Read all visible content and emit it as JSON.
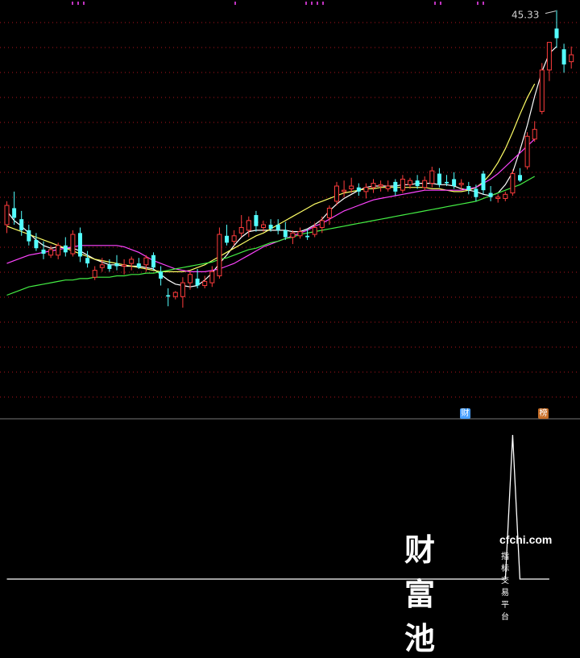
{
  "chart_data": [
    {
      "type": "candlestick",
      "max_label": "45.33",
      "ylim": [
        21,
        45.6
      ],
      "colors": {
        "up": "#ff3c3c",
        "down": "#54ffff",
        "background": "#000000",
        "grid": "#b4141e"
      },
      "candles": [
        {
          "o": 29.8,
          "h": 31.5,
          "l": 29.2,
          "c": 31.2
        },
        {
          "o": 31.0,
          "h": 32.2,
          "l": 29.8,
          "c": 30.3
        },
        {
          "o": 30.2,
          "h": 30.8,
          "l": 29.0,
          "c": 29.4
        },
        {
          "o": 29.4,
          "h": 29.8,
          "l": 28.3,
          "c": 28.6
        },
        {
          "o": 28.7,
          "h": 29.2,
          "l": 27.9,
          "c": 28.1
        },
        {
          "o": 28.0,
          "h": 28.6,
          "l": 27.3,
          "c": 27.7
        },
        {
          "o": 27.6,
          "h": 28.3,
          "l": 27.4,
          "c": 28.0
        },
        {
          "o": 27.6,
          "h": 28.5,
          "l": 27.3,
          "c": 28.3
        },
        {
          "o": 28.3,
          "h": 28.9,
          "l": 27.5,
          "c": 27.8
        },
        {
          "o": 27.7,
          "h": 29.4,
          "l": 27.5,
          "c": 29.1
        },
        {
          "o": 29.2,
          "h": 29.6,
          "l": 27.1,
          "c": 27.5
        },
        {
          "o": 27.4,
          "h": 27.9,
          "l": 26.7,
          "c": 27.0
        },
        {
          "o": 26.0,
          "h": 26.8,
          "l": 25.8,
          "c": 26.5
        },
        {
          "o": 26.7,
          "h": 27.4,
          "l": 26.4,
          "c": 26.9
        },
        {
          "o": 26.9,
          "h": 27.3,
          "l": 26.4,
          "c": 26.6
        },
        {
          "o": 27.0,
          "h": 27.6,
          "l": 26.5,
          "c": 26.8
        },
        {
          "o": 26.8,
          "h": 27.3,
          "l": 26.2,
          "c": 26.9
        },
        {
          "o": 27.0,
          "h": 27.5,
          "l": 26.5,
          "c": 27.3
        },
        {
          "o": 27.0,
          "h": 27.4,
          "l": 26.6,
          "c": 26.7
        },
        {
          "o": 26.9,
          "h": 27.6,
          "l": 26.4,
          "c": 27.4
        },
        {
          "o": 27.6,
          "h": 27.8,
          "l": 26.5,
          "c": 26.7
        },
        {
          "o": 26.4,
          "h": 26.8,
          "l": 25.4,
          "c": 25.9
        },
        {
          "o": 24.7,
          "h": 25.2,
          "l": 23.9,
          "c": 24.6
        },
        {
          "o": 24.6,
          "h": 25.0,
          "l": 24.4,
          "c": 24.9
        },
        {
          "o": 24.6,
          "h": 26.0,
          "l": 23.8,
          "c": 25.6
        },
        {
          "o": 25.6,
          "h": 26.4,
          "l": 25.1,
          "c": 26.2
        },
        {
          "o": 25.9,
          "h": 26.6,
          "l": 25.2,
          "c": 25.4
        },
        {
          "o": 25.4,
          "h": 26.1,
          "l": 25.2,
          "c": 25.7
        },
        {
          "o": 25.6,
          "h": 26.8,
          "l": 25.3,
          "c": 26.4
        },
        {
          "o": 26.1,
          "h": 29.6,
          "l": 25.9,
          "c": 29.1
        },
        {
          "o": 29.0,
          "h": 29.8,
          "l": 28.3,
          "c": 28.5
        },
        {
          "o": 28.6,
          "h": 29.4,
          "l": 28.3,
          "c": 29.0
        },
        {
          "o": 29.2,
          "h": 30.5,
          "l": 28.9,
          "c": 29.6
        },
        {
          "o": 29.4,
          "h": 30.4,
          "l": 28.9,
          "c": 30.1
        },
        {
          "o": 30.5,
          "h": 30.8,
          "l": 29.3,
          "c": 29.7
        },
        {
          "o": 29.6,
          "h": 30.1,
          "l": 29.3,
          "c": 29.8
        },
        {
          "o": 29.8,
          "h": 30.2,
          "l": 29.3,
          "c": 29.5
        },
        {
          "o": 29.8,
          "h": 30.2,
          "l": 29.1,
          "c": 29.4
        },
        {
          "o": 29.4,
          "h": 30.0,
          "l": 28.7,
          "c": 28.9
        },
        {
          "o": 28.9,
          "h": 29.4,
          "l": 28.4,
          "c": 29.2
        },
        {
          "o": 29.0,
          "h": 29.6,
          "l": 28.8,
          "c": 29.3
        },
        {
          "o": 29.0,
          "h": 29.5,
          "l": 28.7,
          "c": 28.9
        },
        {
          "o": 29.1,
          "h": 29.9,
          "l": 28.9,
          "c": 29.6
        },
        {
          "o": 29.6,
          "h": 30.4,
          "l": 29.2,
          "c": 30.1
        },
        {
          "o": 30.3,
          "h": 31.2,
          "l": 29.8,
          "c": 31.0
        },
        {
          "o": 31.5,
          "h": 32.9,
          "l": 31.2,
          "c": 32.6
        },
        {
          "o": 32.2,
          "h": 33.0,
          "l": 31.8,
          "c": 32.3
        },
        {
          "o": 32.4,
          "h": 33.2,
          "l": 32.1,
          "c": 32.6
        },
        {
          "o": 32.5,
          "h": 32.8,
          "l": 31.9,
          "c": 32.2
        },
        {
          "o": 32.2,
          "h": 32.8,
          "l": 31.7,
          "c": 32.5
        },
        {
          "o": 32.5,
          "h": 33.1,
          "l": 32.1,
          "c": 32.8
        },
        {
          "o": 32.6,
          "h": 33.0,
          "l": 32.2,
          "c": 32.7
        },
        {
          "o": 32.4,
          "h": 33.0,
          "l": 32.2,
          "c": 32.6
        },
        {
          "o": 32.9,
          "h": 33.1,
          "l": 31.9,
          "c": 32.2
        },
        {
          "o": 32.3,
          "h": 33.4,
          "l": 32.1,
          "c": 33.1
        },
        {
          "o": 32.7,
          "h": 33.2,
          "l": 32.4,
          "c": 33.0
        },
        {
          "o": 33.0,
          "h": 33.4,
          "l": 32.4,
          "c": 32.6
        },
        {
          "o": 32.5,
          "h": 33.3,
          "l": 32.3,
          "c": 33.0
        },
        {
          "o": 32.8,
          "h": 34.0,
          "l": 32.5,
          "c": 33.7
        },
        {
          "o": 33.5,
          "h": 33.9,
          "l": 32.5,
          "c": 32.7
        },
        {
          "o": 32.9,
          "h": 33.4,
          "l": 32.6,
          "c": 32.8
        },
        {
          "o": 33.1,
          "h": 33.6,
          "l": 32.4,
          "c": 32.6
        },
        {
          "o": 32.7,
          "h": 33.1,
          "l": 32.3,
          "c": 32.8
        },
        {
          "o": 32.6,
          "h": 32.9,
          "l": 32.0,
          "c": 32.3
        },
        {
          "o": 32.4,
          "h": 32.7,
          "l": 31.5,
          "c": 31.8
        },
        {
          "o": 33.5,
          "h": 33.7,
          "l": 32.0,
          "c": 32.3
        },
        {
          "o": 32.1,
          "h": 32.6,
          "l": 31.5,
          "c": 31.8
        },
        {
          "o": 31.7,
          "h": 32.0,
          "l": 31.4,
          "c": 31.8
        },
        {
          "o": 31.7,
          "h": 32.2,
          "l": 31.5,
          "c": 32.0
        },
        {
          "o": 32.1,
          "h": 33.8,
          "l": 31.9,
          "c": 33.5
        },
        {
          "o": 33.4,
          "h": 33.9,
          "l": 32.9,
          "c": 33.0
        },
        {
          "o": 34.0,
          "h": 36.5,
          "l": 33.8,
          "c": 36.2
        },
        {
          "o": 36.0,
          "h": 37.3,
          "l": 35.8,
          "c": 36.7
        },
        {
          "o": 38.0,
          "h": 41.5,
          "l": 37.8,
          "c": 41.0
        },
        {
          "o": 41.0,
          "h": 43.0,
          "l": 40.2,
          "c": 43.0
        },
        {
          "o": 44.0,
          "h": 45.33,
          "l": 42.6,
          "c": 43.3
        },
        {
          "o": 42.5,
          "h": 42.9,
          "l": 40.8,
          "c": 41.4
        },
        {
          "o": 41.6,
          "h": 42.7,
          "l": 41.1,
          "c": 42.1
        }
      ],
      "moving_averages": [
        {
          "color": "#ffffff",
          "values": [
            30.8,
            30.1,
            29.7,
            29.2,
            28.7,
            28.3,
            28.1,
            28.2,
            28.1,
            28.1,
            27.9,
            27.6,
            27.3,
            27.1,
            26.9,
            26.9,
            26.8,
            26.8,
            26.8,
            26.7,
            26.6,
            26.2,
            25.8,
            25.5,
            25.4,
            25.3,
            25.4,
            25.8,
            26.3,
            27.0,
            27.6,
            28.3,
            28.9,
            29.3,
            29.4,
            29.4,
            29.4,
            29.4,
            29.4,
            29.3,
            29.3,
            29.5,
            29.8,
            30.2,
            30.8,
            31.3,
            31.7,
            32.0,
            32.3,
            32.5,
            32.6,
            32.6,
            32.6,
            32.6,
            32.7,
            32.7,
            32.8,
            32.8,
            32.8,
            32.7,
            32.7,
            32.6,
            32.4,
            32.3,
            32.2,
            32.0,
            31.9,
            32.1,
            32.7,
            33.6,
            35.2,
            37.0,
            39.1,
            40.9,
            42.2,
            42.7
          ]
        },
        {
          "color": "#ffff66",
          "values": [
            29.7,
            29.5,
            29.3,
            29.1,
            28.9,
            28.7,
            28.5,
            28.3,
            28.1,
            27.9,
            27.7,
            27.5,
            27.3,
            27.2,
            27.1,
            27.0,
            26.9,
            26.8,
            26.7,
            26.6,
            26.5,
            26.4,
            26.4,
            26.4,
            26.4,
            26.5,
            26.7,
            26.9,
            27.2,
            27.5,
            27.8,
            28.1,
            28.4,
            28.7,
            29.0,
            29.2,
            29.5,
            29.8,
            30.1,
            30.4,
            30.7,
            31.0,
            31.3,
            31.5,
            31.7,
            31.9,
            32.1,
            32.2,
            32.3,
            32.4,
            32.4,
            32.5,
            32.5,
            32.5,
            32.5,
            32.5,
            32.5,
            32.5,
            32.4,
            32.4,
            32.3,
            32.2,
            32.2,
            32.3,
            32.5,
            32.9,
            33.5,
            34.3,
            35.3,
            36.5,
            37.8,
            39.0,
            40.0
          ]
        },
        {
          "color": "#ff44ff",
          "values": [
            27.0,
            27.2,
            27.4,
            27.6,
            27.7,
            27.8,
            27.9,
            28.0,
            28.1,
            28.2,
            28.3,
            28.3,
            28.3,
            28.3,
            28.3,
            28.3,
            28.2,
            28.0,
            27.8,
            27.5,
            27.2,
            27.0,
            26.8,
            26.6,
            26.5,
            26.4,
            26.4,
            26.4,
            26.5,
            26.6,
            26.8,
            27.0,
            27.3,
            27.6,
            27.9,
            28.2,
            28.4,
            28.6,
            28.8,
            29.0,
            29.2,
            29.4,
            29.7,
            29.9,
            30.2,
            30.5,
            30.8,
            31.0,
            31.2,
            31.4,
            31.6,
            31.7,
            31.8,
            31.9,
            32.0,
            32.1,
            32.2,
            32.3,
            32.3,
            32.3,
            32.3,
            32.3,
            32.3,
            32.4,
            32.5,
            32.8,
            33.1,
            33.5,
            34.0,
            34.5,
            35.0,
            35.5,
            36.0
          ]
        },
        {
          "color": "#44ee44",
          "values": [
            24.7,
            24.9,
            25.1,
            25.3,
            25.4,
            25.5,
            25.6,
            25.7,
            25.8,
            25.8,
            25.9,
            25.9,
            26.0,
            26.0,
            26.0,
            26.1,
            26.1,
            26.2,
            26.2,
            26.3,
            26.3,
            26.4,
            26.5,
            26.6,
            26.7,
            26.8,
            26.9,
            27.0,
            27.1,
            27.3,
            27.4,
            27.6,
            27.8,
            28.0,
            28.1,
            28.3,
            28.5,
            28.6,
            28.8,
            28.9,
            29.1,
            29.2,
            29.3,
            29.4,
            29.5,
            29.6,
            29.7,
            29.8,
            29.9,
            30.0,
            30.1,
            30.2,
            30.3,
            30.4,
            30.5,
            30.6,
            30.7,
            30.8,
            30.9,
            31.0,
            31.1,
            31.2,
            31.3,
            31.4,
            31.5,
            31.7,
            31.9,
            32.1,
            32.3,
            32.5,
            32.7,
            33.0,
            33.3
          ]
        }
      ],
      "markers": [
        "财",
        "榜"
      ]
    },
    {
      "type": "line",
      "color": "#ffffff",
      "values": [
        0,
        0,
        0,
        0,
        0,
        0,
        0,
        0,
        0,
        0,
        0,
        0,
        0,
        0,
        0,
        0,
        0,
        0,
        0,
        0,
        0,
        0,
        0,
        0,
        0,
        0,
        0,
        0,
        0,
        0,
        0,
        0,
        0,
        0,
        0,
        0,
        0,
        0,
        0,
        0,
        0,
        0,
        0,
        0,
        0,
        0,
        0,
        0,
        0,
        0,
        0,
        0,
        0,
        0,
        0,
        0,
        0,
        0,
        0,
        0,
        0,
        0,
        0,
        0,
        0,
        0,
        0,
        0,
        0,
        1,
        0,
        0,
        0,
        0,
        0
      ],
      "ylim": [
        0,
        1
      ]
    }
  ],
  "watermark": {
    "brand": "财富池",
    "url": "cfchi.com",
    "tagline": "指标交易平台"
  }
}
